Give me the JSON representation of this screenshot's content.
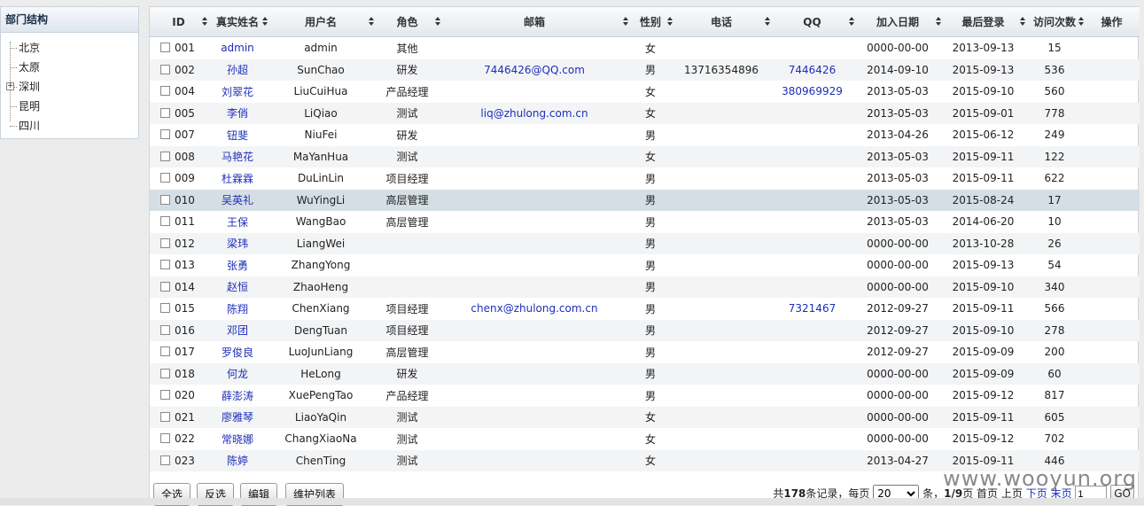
{
  "sidebar": {
    "title": "部门结构",
    "items": [
      {
        "label": "北京",
        "expandable": false
      },
      {
        "label": "太原",
        "expandable": false
      },
      {
        "label": "深圳",
        "expandable": true
      },
      {
        "label": "昆明",
        "expandable": false
      },
      {
        "label": "四川",
        "expandable": false
      }
    ]
  },
  "table": {
    "headers": [
      "ID",
      "真实姓名",
      "用户名",
      "角色",
      "邮箱",
      "性别",
      "电话",
      "QQ",
      "加入日期",
      "最后登录",
      "访问次数",
      "操作"
    ],
    "rows": [
      {
        "id": "001",
        "name": "admin",
        "username": "admin",
        "role": "其他",
        "email": "",
        "gender": "女",
        "phone": "",
        "qq": "",
        "joined": "0000-00-00",
        "last_login": "2013-09-13",
        "visits": "15"
      },
      {
        "id": "002",
        "name": "孙超",
        "username": "SunChao",
        "role": "研发",
        "email": "7446426@QQ.com",
        "gender": "男",
        "phone": "13716354896",
        "qq": "7446426",
        "joined": "2014-09-10",
        "last_login": "2015-09-13",
        "visits": "536"
      },
      {
        "id": "004",
        "name": "刘翠花",
        "username": "LiuCuiHua",
        "role": "产品经理",
        "email": "",
        "gender": "女",
        "phone": "",
        "qq": "380969929",
        "joined": "2013-05-03",
        "last_login": "2015-09-10",
        "visits": "560"
      },
      {
        "id": "005",
        "name": "李俏",
        "username": "LiQiao",
        "role": "测试",
        "email": "liq@zhulong.com.cn",
        "gender": "女",
        "phone": "",
        "qq": "",
        "joined": "2013-05-03",
        "last_login": "2015-09-01",
        "visits": "778"
      },
      {
        "id": "007",
        "name": "钮斐",
        "username": "NiuFei",
        "role": "研发",
        "email": "",
        "gender": "男",
        "phone": "",
        "qq": "",
        "joined": "2013-04-26",
        "last_login": "2015-06-12",
        "visits": "249"
      },
      {
        "id": "008",
        "name": "马艳花",
        "username": "MaYanHua",
        "role": "测试",
        "email": "",
        "gender": "女",
        "phone": "",
        "qq": "",
        "joined": "2013-05-03",
        "last_login": "2015-09-11",
        "visits": "122"
      },
      {
        "id": "009",
        "name": "杜霖霖",
        "username": "DuLinLin",
        "role": "项目经理",
        "email": "",
        "gender": "男",
        "phone": "",
        "qq": "",
        "joined": "2013-05-03",
        "last_login": "2015-09-11",
        "visits": "622"
      },
      {
        "id": "010",
        "name": "吴英礼",
        "username": "WuYingLi",
        "role": "高层管理",
        "email": "",
        "gender": "男",
        "phone": "",
        "qq": "",
        "joined": "2013-05-03",
        "last_login": "2015-08-24",
        "visits": "17"
      },
      {
        "id": "011",
        "name": "王保",
        "username": "WangBao",
        "role": "高层管理",
        "email": "",
        "gender": "男",
        "phone": "",
        "qq": "",
        "joined": "2013-05-03",
        "last_login": "2014-06-20",
        "visits": "10"
      },
      {
        "id": "012",
        "name": "梁玮",
        "username": "LiangWei",
        "role": "",
        "email": "",
        "gender": "男",
        "phone": "",
        "qq": "",
        "joined": "0000-00-00",
        "last_login": "2013-10-28",
        "visits": "26"
      },
      {
        "id": "013",
        "name": "张勇",
        "username": "ZhangYong",
        "role": "",
        "email": "",
        "gender": "男",
        "phone": "",
        "qq": "",
        "joined": "0000-00-00",
        "last_login": "2015-09-13",
        "visits": "54"
      },
      {
        "id": "014",
        "name": "赵恒",
        "username": "ZhaoHeng",
        "role": "",
        "email": "",
        "gender": "男",
        "phone": "",
        "qq": "",
        "joined": "0000-00-00",
        "last_login": "2015-09-10",
        "visits": "340"
      },
      {
        "id": "015",
        "name": "陈翔",
        "username": "ChenXiang",
        "role": "项目经理",
        "email": "chenx@zhulong.com.cn",
        "gender": "男",
        "phone": "",
        "qq": "7321467",
        "joined": "2012-09-27",
        "last_login": "2015-09-11",
        "visits": "566"
      },
      {
        "id": "016",
        "name": "邓团",
        "username": "DengTuan",
        "role": "项目经理",
        "email": "",
        "gender": "男",
        "phone": "",
        "qq": "",
        "joined": "2012-09-27",
        "last_login": "2015-09-10",
        "visits": "278"
      },
      {
        "id": "017",
        "name": "罗俊良",
        "username": "LuoJunLiang",
        "role": "高层管理",
        "email": "",
        "gender": "男",
        "phone": "",
        "qq": "",
        "joined": "2012-09-27",
        "last_login": "2015-09-09",
        "visits": "200"
      },
      {
        "id": "018",
        "name": "何龙",
        "username": "HeLong",
        "role": "研发",
        "email": "",
        "gender": "男",
        "phone": "",
        "qq": "",
        "joined": "0000-00-00",
        "last_login": "2015-09-09",
        "visits": "60"
      },
      {
        "id": "020",
        "name": "薛澎涛",
        "username": "XuePengTao",
        "role": "产品经理",
        "email": "",
        "gender": "男",
        "phone": "",
        "qq": "",
        "joined": "0000-00-00",
        "last_login": "2015-09-12",
        "visits": "817"
      },
      {
        "id": "021",
        "name": "廖雅琴",
        "username": "LiaoYaQin",
        "role": "测试",
        "email": "",
        "gender": "女",
        "phone": "",
        "qq": "",
        "joined": "0000-00-00",
        "last_login": "2015-09-11",
        "visits": "605"
      },
      {
        "id": "022",
        "name": "常晓娜",
        "username": "ChangXiaoNa",
        "role": "测试",
        "email": "",
        "gender": "女",
        "phone": "",
        "qq": "",
        "joined": "0000-00-00",
        "last_login": "2015-09-12",
        "visits": "702"
      },
      {
        "id": "023",
        "name": "陈婷",
        "username": "ChenTing",
        "role": "测试",
        "email": "",
        "gender": "女",
        "phone": "",
        "qq": "",
        "joined": "2013-04-27",
        "last_login": "2015-09-11",
        "visits": "446"
      }
    ],
    "selected_row_id": "010"
  },
  "footer": {
    "buttons": {
      "select_all": "全选",
      "invert": "反选",
      "edit": "编辑",
      "maintain_list": "维护列表"
    },
    "pager": {
      "total_prefix": "共",
      "total": "178",
      "total_suffix": "条记录，每页",
      "page_size": "20",
      "page_size_suffix": "条，",
      "page_info": "1/9",
      "page_suffix": "页",
      "first": "首页",
      "prev": "上页",
      "next": "下页",
      "last": "末页",
      "page_input": "1",
      "go": "GO"
    }
  },
  "watermark": "www.wooyun.org",
  "colors": {
    "link": "#1d2fb8",
    "selected_row": "#d4dee4",
    "stripe": "#f3f4f6"
  }
}
